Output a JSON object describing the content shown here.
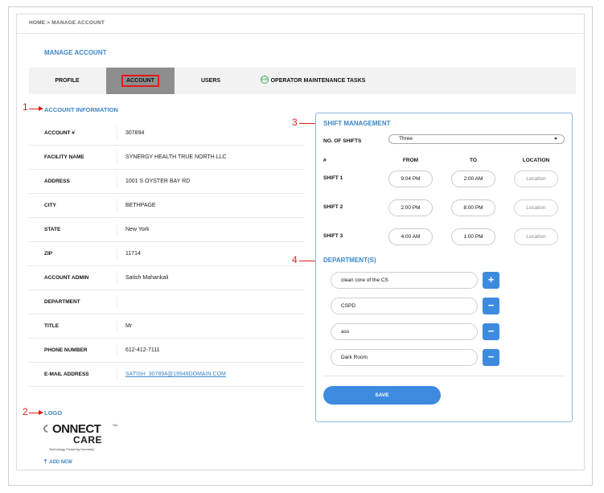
{
  "breadcrumb": "HOME  >  MANAGE ACCOUNT",
  "page_title": "MANAGE ACCOUNT",
  "tabs": [
    {
      "label": "PROFILE"
    },
    {
      "label": "ACCOUNT"
    },
    {
      "label": "USERS"
    },
    {
      "label": "OPERATOR MAINTENANCE TASKS",
      "icon_text": "OTE"
    }
  ],
  "annotations": [
    "1",
    "2",
    "3",
    "4"
  ],
  "account_info": {
    "title": "ACCOUNT INFORMATION",
    "rows": [
      {
        "key": "ACCOUNT #",
        "value": "307894"
      },
      {
        "key": "FACILITY NAME",
        "value": "SYNERGY HEALTH TRUE NORTH LLC"
      },
      {
        "key": "ADDRESS",
        "value": "1001 S OYSTER BAY RD"
      },
      {
        "key": "CITY",
        "value": "BETHPAGE"
      },
      {
        "key": "STATE",
        "value": "New York"
      },
      {
        "key": "ZIP",
        "value": "11714"
      },
      {
        "key": "ACCOUNT ADMIN",
        "value": "Satish Mahankali"
      },
      {
        "key": "DEPARTMENT",
        "value": ""
      },
      {
        "key": "TITLE",
        "value": "Mr"
      },
      {
        "key": "PHONE NUMBER",
        "value": "612-412-7111"
      },
      {
        "key": "E-MAIL ADDRESS",
        "value": "SATISH_307894@19948DOMAIN.COM"
      }
    ]
  },
  "logo": {
    "title": "LOGO",
    "brand_main": "ONNECT",
    "brand_care": "CARE",
    "brand_sm": "SM",
    "tagline": "Technology Powering Humanity",
    "add_new": "ADD NEW"
  },
  "shift_management": {
    "title": "SHIFT MANAGEMENT",
    "no_of_shifts_label": "NO. OF SHIFTS",
    "no_of_shifts_value": "Three",
    "columns": {
      "num": "#",
      "from": "FROM",
      "to": "TO",
      "location": "LOCATION"
    },
    "shifts": [
      {
        "name": "SHIFT 1",
        "from": "9:04 PM",
        "to": "2:00 AM",
        "location": "Location"
      },
      {
        "name": "SHIFT 2",
        "from": "2:00 PM",
        "to": "8:00 PM",
        "location": "Location"
      },
      {
        "name": "SHIFT 3",
        "from": "4:00 AM",
        "to": "1:00 PM",
        "location": "Location"
      }
    ]
  },
  "departments": {
    "title": "DEPARTMENT(S)",
    "items": [
      {
        "value": "clean core of the CS",
        "action": "+"
      },
      {
        "value": "CSPD",
        "action": "−"
      },
      {
        "value": "ass",
        "action": "−"
      },
      {
        "value": "Dark Room",
        "action": "−"
      }
    ]
  },
  "save_label": "SAVE",
  "colors": {
    "accent": "#3d87c7",
    "button": "#3d8ae0",
    "annotation": "#e21b1b",
    "active_tab": "#8e8e8e"
  }
}
